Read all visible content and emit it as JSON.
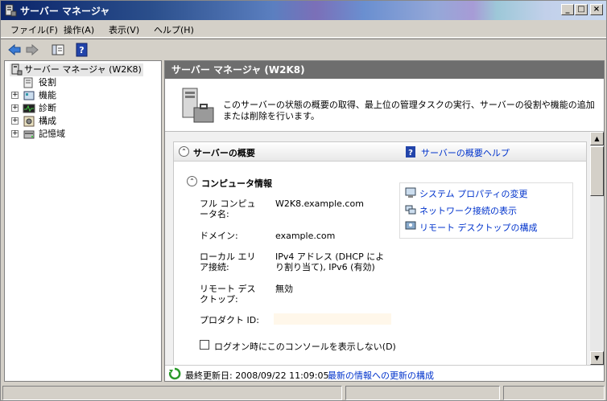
{
  "window": {
    "title": "サーバー マネージャ",
    "buttons": {
      "minimize": "_",
      "maximize": "□",
      "close": "×"
    }
  },
  "menu": [
    {
      "label": "ファイル(F)"
    },
    {
      "label": "操作(A)"
    },
    {
      "label": "表示(V)"
    },
    {
      "label": "ヘルプ(H)"
    }
  ],
  "tree": {
    "root": "サーバー マネージャ (W2K8)",
    "items": [
      {
        "label": "役割",
        "expandable": false
      },
      {
        "label": "機能",
        "expandable": true
      },
      {
        "label": "診断",
        "expandable": true
      },
      {
        "label": "構成",
        "expandable": true
      },
      {
        "label": "記憶域",
        "expandable": true
      }
    ],
    "expand_glyph": "+"
  },
  "main": {
    "header": "サーバー マネージャ (W2K8)",
    "description": "このサーバーの状態の概要の取得、最上位の管理タスクの実行、サーバーの役割や機能の追加または削除を行います。",
    "overview": {
      "title": "サーバーの概要",
      "help_link": "サーバーの概要ヘルプ",
      "collapse_glyph": "⌃"
    },
    "computer_info": {
      "title": "コンピュータ情報",
      "fields": [
        {
          "label": "フル コンピュータ名:",
          "value": "W2K8.example.com"
        },
        {
          "label": "ドメイン:",
          "value": "example.com"
        },
        {
          "label": "ローカル エリア接続:",
          "value": "IPv4 アドレス (DHCP により割り当て), IPv6 (有効)"
        },
        {
          "label": "リモート デスクトップ:",
          "value": "無効"
        },
        {
          "label": "プロダクト ID:",
          "value": ""
        }
      ],
      "tasks": [
        {
          "label": "システム プロパティの変更"
        },
        {
          "label": "ネットワーク接続の表示"
        },
        {
          "label": "リモート デスクトップの構成"
        }
      ],
      "checkbox_label": "ログオン時にこのコンソールを表示しない(D)",
      "checkbox_checked": false
    },
    "status": {
      "last_updated": "最終更新日: 2008/09/22 11:09:05",
      "configure_link": "最新の情報への更新の構成"
    }
  },
  "colors": {
    "header_bg": "#6e6e6e",
    "link": "#0033cc",
    "titlebar_start": "#0a246a"
  }
}
